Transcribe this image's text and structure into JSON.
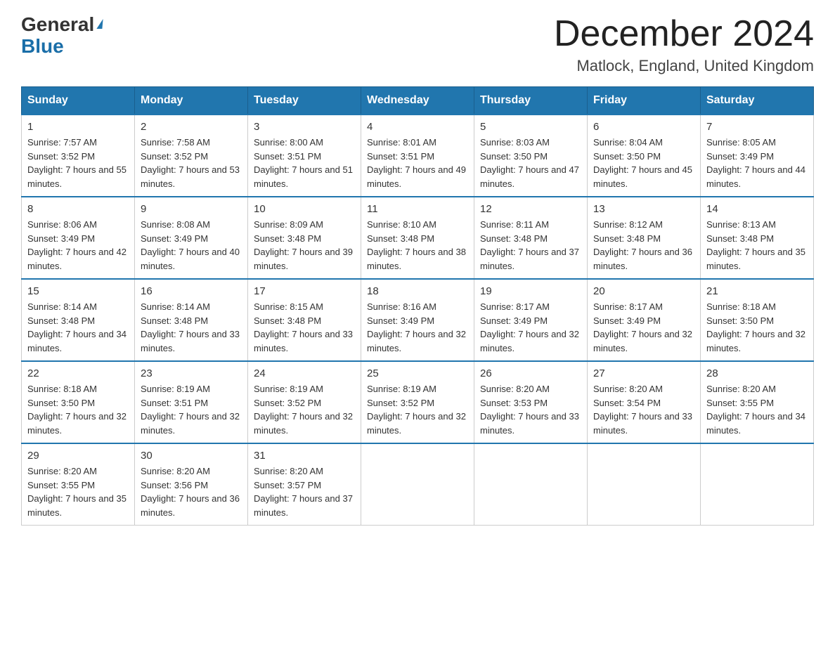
{
  "logo": {
    "general": "General",
    "blue": "Blue"
  },
  "title": "December 2024",
  "location": "Matlock, England, United Kingdom",
  "days_of_week": [
    "Sunday",
    "Monday",
    "Tuesday",
    "Wednesday",
    "Thursday",
    "Friday",
    "Saturday"
  ],
  "weeks": [
    [
      {
        "num": "1",
        "sunrise": "7:57 AM",
        "sunset": "3:52 PM",
        "daylight": "7 hours and 55 minutes."
      },
      {
        "num": "2",
        "sunrise": "7:58 AM",
        "sunset": "3:52 PM",
        "daylight": "7 hours and 53 minutes."
      },
      {
        "num": "3",
        "sunrise": "8:00 AM",
        "sunset": "3:51 PM",
        "daylight": "7 hours and 51 minutes."
      },
      {
        "num": "4",
        "sunrise": "8:01 AM",
        "sunset": "3:51 PM",
        "daylight": "7 hours and 49 minutes."
      },
      {
        "num": "5",
        "sunrise": "8:03 AM",
        "sunset": "3:50 PM",
        "daylight": "7 hours and 47 minutes."
      },
      {
        "num": "6",
        "sunrise": "8:04 AM",
        "sunset": "3:50 PM",
        "daylight": "7 hours and 45 minutes."
      },
      {
        "num": "7",
        "sunrise": "8:05 AM",
        "sunset": "3:49 PM",
        "daylight": "7 hours and 44 minutes."
      }
    ],
    [
      {
        "num": "8",
        "sunrise": "8:06 AM",
        "sunset": "3:49 PM",
        "daylight": "7 hours and 42 minutes."
      },
      {
        "num": "9",
        "sunrise": "8:08 AM",
        "sunset": "3:49 PM",
        "daylight": "7 hours and 40 minutes."
      },
      {
        "num": "10",
        "sunrise": "8:09 AM",
        "sunset": "3:48 PM",
        "daylight": "7 hours and 39 minutes."
      },
      {
        "num": "11",
        "sunrise": "8:10 AM",
        "sunset": "3:48 PM",
        "daylight": "7 hours and 38 minutes."
      },
      {
        "num": "12",
        "sunrise": "8:11 AM",
        "sunset": "3:48 PM",
        "daylight": "7 hours and 37 minutes."
      },
      {
        "num": "13",
        "sunrise": "8:12 AM",
        "sunset": "3:48 PM",
        "daylight": "7 hours and 36 minutes."
      },
      {
        "num": "14",
        "sunrise": "8:13 AM",
        "sunset": "3:48 PM",
        "daylight": "7 hours and 35 minutes."
      }
    ],
    [
      {
        "num": "15",
        "sunrise": "8:14 AM",
        "sunset": "3:48 PM",
        "daylight": "7 hours and 34 minutes."
      },
      {
        "num": "16",
        "sunrise": "8:14 AM",
        "sunset": "3:48 PM",
        "daylight": "7 hours and 33 minutes."
      },
      {
        "num": "17",
        "sunrise": "8:15 AM",
        "sunset": "3:48 PM",
        "daylight": "7 hours and 33 minutes."
      },
      {
        "num": "18",
        "sunrise": "8:16 AM",
        "sunset": "3:49 PM",
        "daylight": "7 hours and 32 minutes."
      },
      {
        "num": "19",
        "sunrise": "8:17 AM",
        "sunset": "3:49 PM",
        "daylight": "7 hours and 32 minutes."
      },
      {
        "num": "20",
        "sunrise": "8:17 AM",
        "sunset": "3:49 PM",
        "daylight": "7 hours and 32 minutes."
      },
      {
        "num": "21",
        "sunrise": "8:18 AM",
        "sunset": "3:50 PM",
        "daylight": "7 hours and 32 minutes."
      }
    ],
    [
      {
        "num": "22",
        "sunrise": "8:18 AM",
        "sunset": "3:50 PM",
        "daylight": "7 hours and 32 minutes."
      },
      {
        "num": "23",
        "sunrise": "8:19 AM",
        "sunset": "3:51 PM",
        "daylight": "7 hours and 32 minutes."
      },
      {
        "num": "24",
        "sunrise": "8:19 AM",
        "sunset": "3:52 PM",
        "daylight": "7 hours and 32 minutes."
      },
      {
        "num": "25",
        "sunrise": "8:19 AM",
        "sunset": "3:52 PM",
        "daylight": "7 hours and 32 minutes."
      },
      {
        "num": "26",
        "sunrise": "8:20 AM",
        "sunset": "3:53 PM",
        "daylight": "7 hours and 33 minutes."
      },
      {
        "num": "27",
        "sunrise": "8:20 AM",
        "sunset": "3:54 PM",
        "daylight": "7 hours and 33 minutes."
      },
      {
        "num": "28",
        "sunrise": "8:20 AM",
        "sunset": "3:55 PM",
        "daylight": "7 hours and 34 minutes."
      }
    ],
    [
      {
        "num": "29",
        "sunrise": "8:20 AM",
        "sunset": "3:55 PM",
        "daylight": "7 hours and 35 minutes."
      },
      {
        "num": "30",
        "sunrise": "8:20 AM",
        "sunset": "3:56 PM",
        "daylight": "7 hours and 36 minutes."
      },
      {
        "num": "31",
        "sunrise": "8:20 AM",
        "sunset": "3:57 PM",
        "daylight": "7 hours and 37 minutes."
      },
      null,
      null,
      null,
      null
    ]
  ]
}
